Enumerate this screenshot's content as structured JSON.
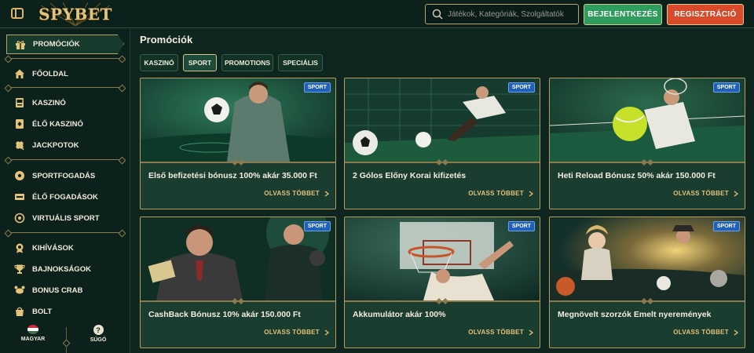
{
  "header": {
    "logo_text": "SPYBET",
    "search_placeholder": "Játékok, Kategóriák, Szolgáltatók",
    "login_label": "BEJELENTKEZÉS",
    "register_label": "REGISZTRÁCIÓ"
  },
  "sidebar": {
    "active": {
      "label": "PROMÓCIÓK",
      "icon": "gift-icon"
    },
    "group1": [
      {
        "label": "FŐOLDAL",
        "icon": "home-icon"
      }
    ],
    "group2": [
      {
        "label": "KASZINÓ",
        "icon": "slot-machine-icon"
      },
      {
        "label": "ÉLŐ KASZINÓ",
        "icon": "live-cards-icon"
      },
      {
        "label": "JACKPOTOK",
        "icon": "clover-icon"
      }
    ],
    "group3": [
      {
        "label": "SPORTFOGADÁS",
        "icon": "soccer-ball-icon"
      },
      {
        "label": "ÉLŐ FOGADÁSOK",
        "icon": "live-tv-icon"
      },
      {
        "label": "VIRTUÁLIS SPORT",
        "icon": "virtual-sport-icon"
      }
    ],
    "group4": [
      {
        "label": "KIHÍVÁSOK",
        "icon": "medal-icon"
      },
      {
        "label": "BAJNOKSÁGOK",
        "icon": "trophy-icon"
      },
      {
        "label": "BONUS CRAB",
        "icon": "crab-icon"
      },
      {
        "label": "BOLT",
        "icon": "shop-bag-icon"
      }
    ],
    "language_label": "MAGYAR",
    "help_label": "SÚGÓ",
    "help_glyph": "?"
  },
  "main": {
    "title": "Promóciók",
    "tabs": [
      {
        "label": "KASZINÓ",
        "active": false
      },
      {
        "label": "SPORT",
        "active": true
      },
      {
        "label": "PROMOTIONS",
        "active": false
      },
      {
        "label": "SPECIÁLIS",
        "active": false
      }
    ],
    "read_more": "OLVASS TÖBBET",
    "cards": [
      {
        "title": "Első befizetési bónusz 100% akár 35.000 Ft",
        "badge": "SPORT"
      },
      {
        "title": "2 Gólos Előny Korai kifizetés",
        "badge": "SPORT"
      },
      {
        "title": "Heti Reload Bónusz 50% akár 150.000 Ft",
        "badge": "SPORT"
      },
      {
        "title": "CashBack Bónusz 10% akár 150.000 Ft",
        "badge": "SPORT"
      },
      {
        "title": "Akkumulátor akár 100%",
        "badge": "SPORT"
      },
      {
        "title": "Megnövelt szorzók Emelt nyeremények",
        "badge": "SPORT"
      }
    ]
  },
  "colors": {
    "background": "#0f2620",
    "gold": "#e3c27a",
    "login_green": "#2e9c5c",
    "register_red": "#d84a2a",
    "badge_blue": "#2060b8"
  }
}
